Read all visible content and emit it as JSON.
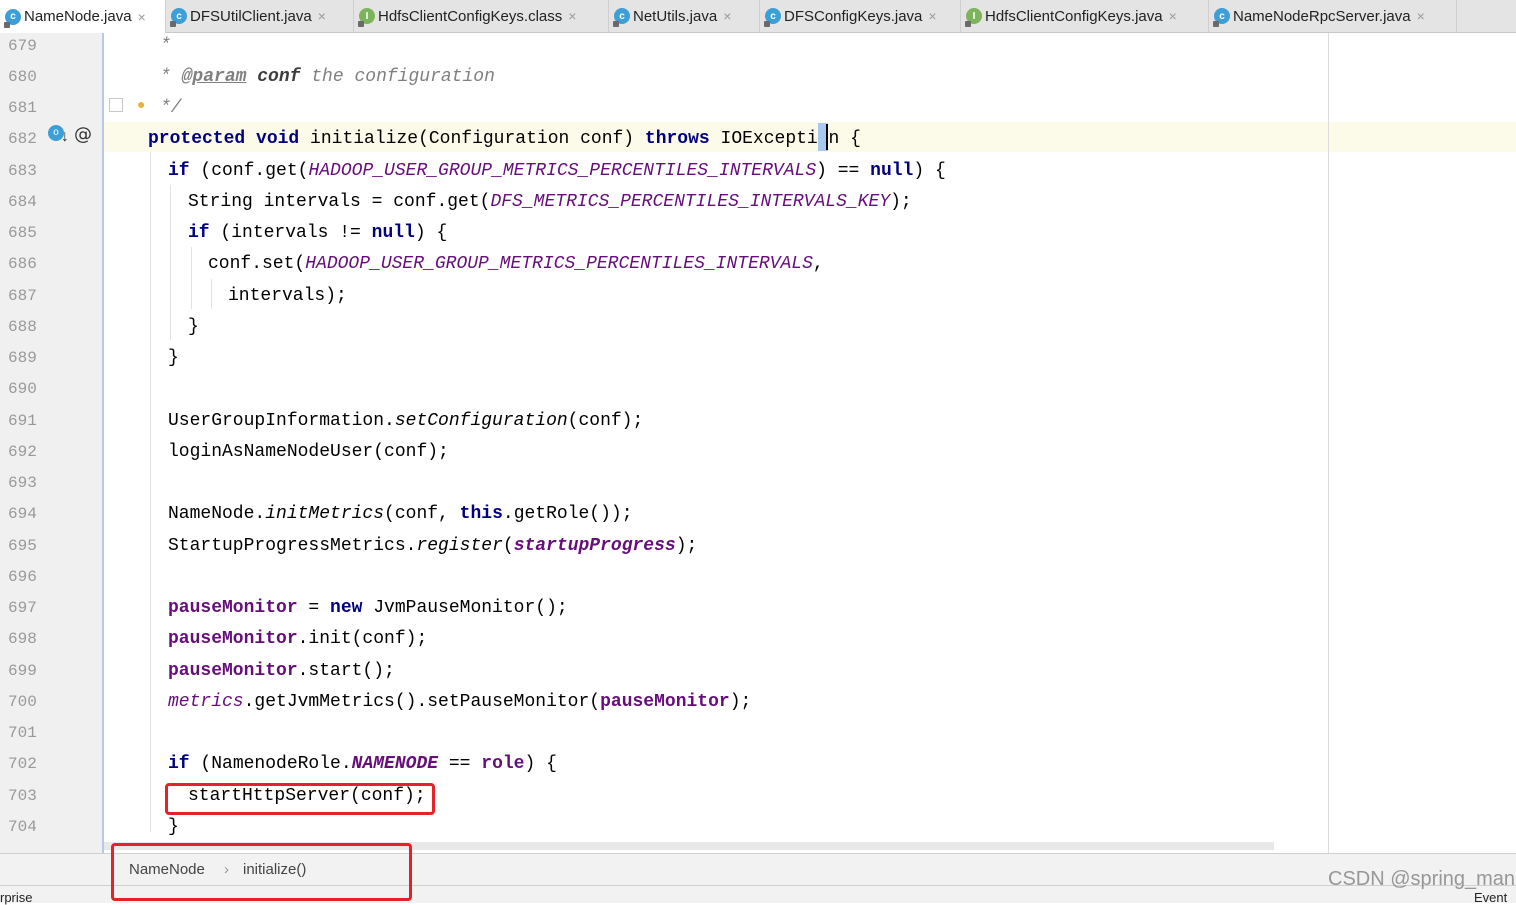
{
  "tabs": [
    {
      "label": "NameNode.java",
      "icon": "class-icon",
      "active": true
    },
    {
      "label": "DFSUtilClient.java",
      "icon": "class-icon",
      "active": false
    },
    {
      "label": "HdfsClientConfigKeys.class",
      "icon": "interface-icon",
      "active": false
    },
    {
      "label": "NetUtils.java",
      "icon": "class-icon",
      "active": false
    },
    {
      "label": "DFSConfigKeys.java",
      "icon": "class-icon",
      "active": false
    },
    {
      "label": "HdfsClientConfigKeys.java",
      "icon": "interface-icon",
      "active": false
    },
    {
      "label": "NameNodeRpcServer.java",
      "icon": "class-icon",
      "active": false
    }
  ],
  "tab_close_glyph": "×",
  "line_numbers": [
    "679",
    "680",
    "681",
    "682",
    "683",
    "684",
    "685",
    "686",
    "687",
    "688",
    "689",
    "690",
    "691",
    "692",
    "693",
    "694",
    "695",
    "696",
    "697",
    "698",
    "699",
    "700",
    "701",
    "702",
    "703",
    "704"
  ],
  "code": {
    "l679": "*",
    "l680_star": "* ",
    "l680_tag": "@param",
    "l680_name": "conf",
    "l680_text": " the configuration",
    "l681": "*/",
    "l682_kw1": "protected",
    "l682_kw2": "void",
    "l682_sig": " initialize(Configuration conf) ",
    "l682_kw3": "throws",
    "l682_exc": " IOException ",
    "l682_brace": "{",
    "l683_kw": "if",
    "l683_a": " (conf.get(",
    "l683_const": "HADOOP_USER_GROUP_METRICS_PERCENTILES_INTERVALS",
    "l683_b": ") == ",
    "l683_null": "null",
    "l683_c": ") {",
    "l684_a": "String intervals = conf.get(",
    "l684_const": "DFS_METRICS_PERCENTILES_INTERVALS_KEY",
    "l684_b": ");",
    "l685_kw": "if",
    "l685_a": " (intervals != ",
    "l685_null": "null",
    "l685_b": ") {",
    "l686_a": "conf.set(",
    "l686_const": "HADOOP_USER_GROUP_METRICS_PERCENTILES_INTERVALS",
    "l686_b": ",",
    "l687": "intervals);",
    "l688": "}",
    "l689": "}",
    "l691_a": "UserGroupInformation.",
    "l691_m": "setConfiguration",
    "l691_b": "(conf);",
    "l692": "loginAsNameNodeUser(conf);",
    "l694_a": "NameNode.",
    "l694_m": "initMetrics",
    "l694_b": "(conf, ",
    "l694_kw": "this",
    "l694_c": ".getRole());",
    "l695_a": "StartupProgressMetrics.",
    "l695_m": "register",
    "l695_b": "(",
    "l695_f": "startupProgress",
    "l695_c": ");",
    "l697_f": "pauseMonitor",
    "l697_a": " = ",
    "l697_kw": "new",
    "l697_b": " JvmPauseMonitor();",
    "l698_f": "pauseMonitor",
    "l698_a": ".init(conf);",
    "l699_f": "pauseMonitor",
    "l699_a": ".start();",
    "l700_f": "metrics",
    "l700_a": ".getJvmMetrics().setPauseMonitor(",
    "l700_f2": "pauseMonitor",
    "l700_b": ");",
    "l702_kw": "if",
    "l702_a": " (NamenodeRole.",
    "l702_const": "NAMENODE",
    "l702_b": " == ",
    "l702_f": "role",
    "l702_c": ") {",
    "l703": "startHttpServer(conf);",
    "l704": "}"
  },
  "breadcrumb": {
    "class": "NameNode",
    "separator": "›",
    "method": "initialize()"
  },
  "status": {
    "left": "rprise",
    "right": "Event"
  },
  "watermark": "CSDN @spring_man",
  "colors": {
    "keyword": "#000080",
    "constant": "#660e7a",
    "comment": "#808080",
    "highlight_box": "#e8202a",
    "current_line": "#fcfae8"
  }
}
